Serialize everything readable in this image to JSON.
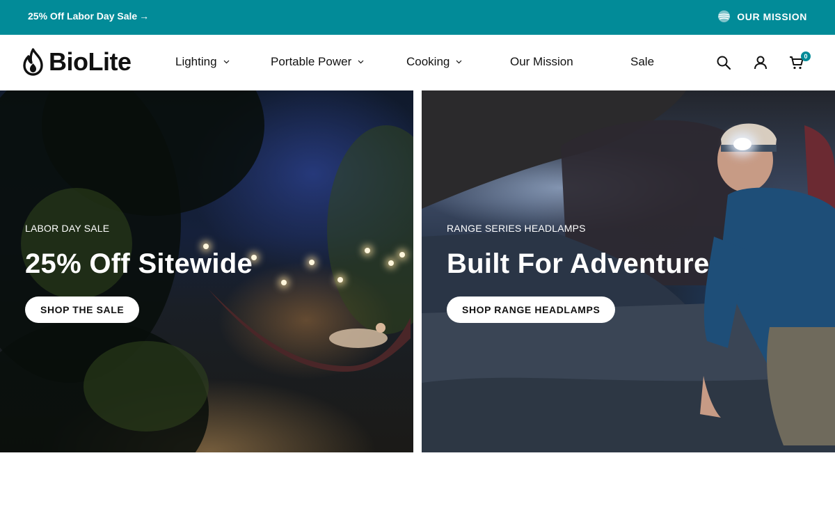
{
  "announcement": {
    "promo_text": "25% Off Labor Day Sale",
    "promo_arrow": "→",
    "mission_label": "OUR MISSION"
  },
  "header": {
    "logo_text": "BioLite",
    "nav": [
      {
        "label": "Lighting",
        "has_dropdown": true
      },
      {
        "label": "Portable Power",
        "has_dropdown": true
      },
      {
        "label": "Cooking",
        "has_dropdown": true
      },
      {
        "label": "Our Mission",
        "has_dropdown": false
      },
      {
        "label": "Sale",
        "has_dropdown": false
      }
    ],
    "icons": [
      "search-icon",
      "account-icon",
      "cart-icon"
    ],
    "cart_count": "0"
  },
  "heroes": [
    {
      "eyebrow": "LABOR DAY SALE",
      "title": "25% Off Sitewide",
      "cta_label": "SHOP THE SALE",
      "image": "hammock-under-string-lights-at-night"
    },
    {
      "eyebrow": "RANGE SERIES HEADLAMPS",
      "title": "Built For Adventure",
      "cta_label": "SHOP RANGE HEADLAMPS",
      "image": "hiker-with-headlamp-under-rock"
    }
  ],
  "colors": {
    "brand_teal": "#028b98",
    "text": "#111111",
    "background": "#ffffff"
  }
}
